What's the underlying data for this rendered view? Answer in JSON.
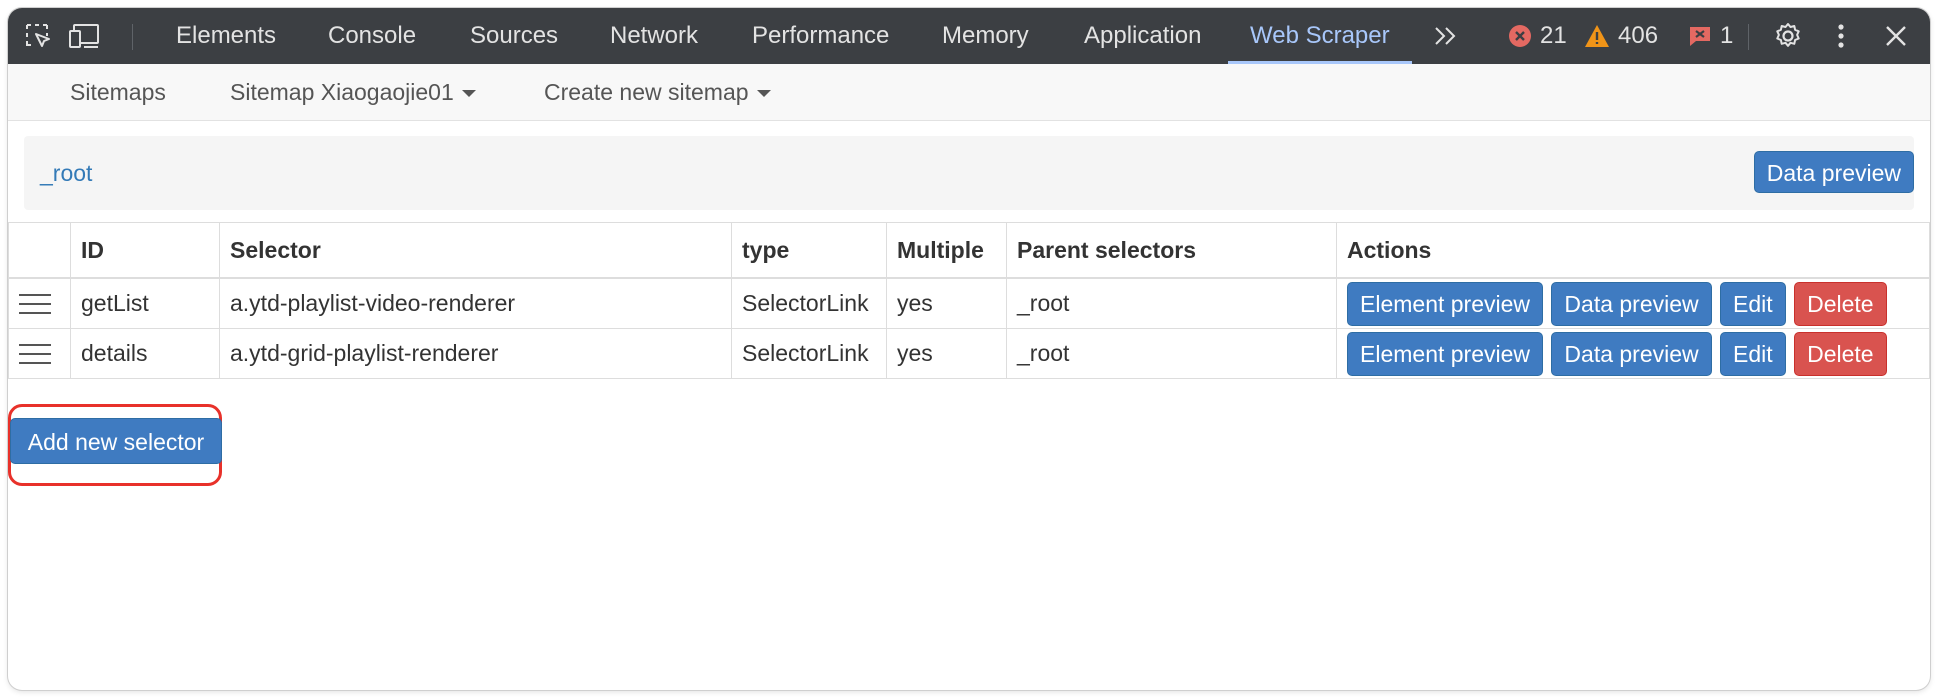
{
  "devtools": {
    "tabs": [
      "Elements",
      "Console",
      "Sources",
      "Network",
      "Performance",
      "Memory",
      "Application",
      "Web Scraper"
    ],
    "active_tab": "Web Scraper",
    "errors": "21",
    "warnings": "406",
    "issues": "1",
    "colors": {
      "error": "#e46962",
      "warning": "#f09418",
      "issue": "#e46962",
      "active": "#a8c7fa"
    }
  },
  "nav": {
    "sitemaps": "Sitemaps",
    "current_sitemap": "Sitemap Xiaogaojie01",
    "create_sitemap": "Create new sitemap"
  },
  "breadcrumb": {
    "root": "_root",
    "data_preview": "Data preview"
  },
  "table": {
    "headers": [
      "",
      "ID",
      "Selector",
      "type",
      "Multiple",
      "Parent selectors",
      "Actions"
    ],
    "rows": [
      {
        "id": "getList",
        "selector": "a.ytd-playlist-video-renderer",
        "type": "SelectorLink",
        "multiple": "yes",
        "parent": "_root"
      },
      {
        "id": "details",
        "selector": "a.ytd-grid-playlist-renderer",
        "type": "SelectorLink",
        "multiple": "yes",
        "parent": "_root"
      }
    ],
    "actions": {
      "element_preview": "Element preview",
      "data_preview": "Data preview",
      "edit": "Edit",
      "delete": "Delete"
    }
  },
  "add_selector": "Add new selector",
  "colors": {
    "primary": "#3f7bc1",
    "danger": "#d9534f",
    "link": "#337ab7",
    "highlight": "#e8312a"
  }
}
